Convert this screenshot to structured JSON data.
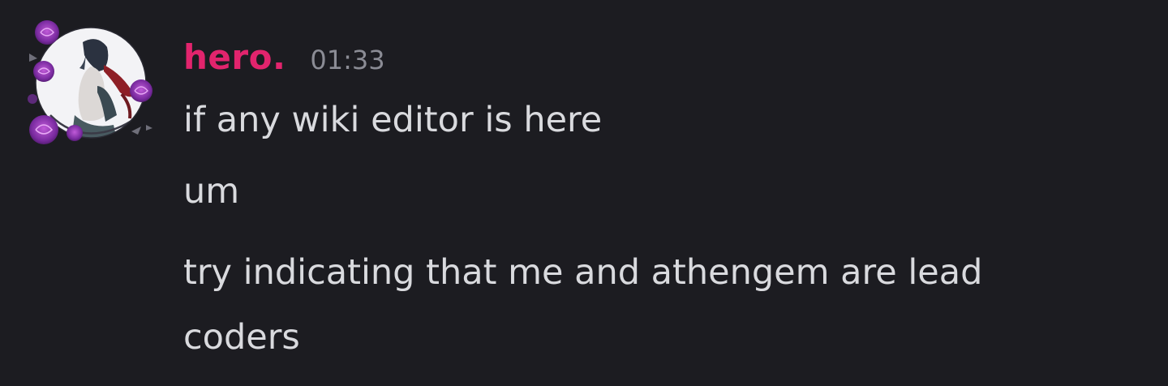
{
  "message": {
    "username": "hero.",
    "timestamp": "01:33",
    "username_color": "#e2246d",
    "lines": [
      "if any wiki editor is here",
      "um",
      "try indicating that me and athengem are lead coders"
    ]
  },
  "avatar": {
    "icon": "rose-framed-anime-avatar",
    "accent": "#8a35b8"
  },
  "theme": {
    "background": "#1c1c21",
    "text": "#d9dade",
    "muted": "#8b8c95"
  }
}
